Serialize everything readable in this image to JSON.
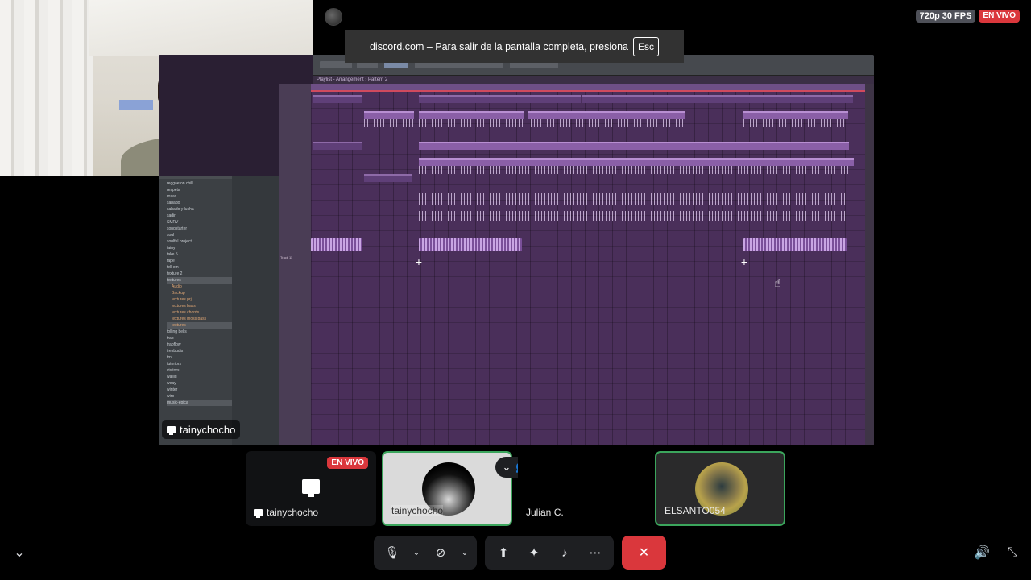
{
  "stream": {
    "quality": "720p 30 FPS",
    "live_label": "EN VIVO"
  },
  "toast": {
    "message": "discord.com – Para salir de la pantalla completa, presiona",
    "key": "Esc"
  },
  "shared_screen": {
    "owner": "tainychocho",
    "fl_title": "Playlist - Arrangement › Pattern 2",
    "track_label": "Track 11",
    "browser_items": [
      "reggaeton chill",
      "respeta",
      "rosas",
      "sabado",
      "sabado y lucha",
      "sadir",
      "SMRV",
      "songstarter",
      "soul",
      "soulful project",
      "tainy",
      "take 5",
      "tape",
      "tell em",
      "texture 2",
      "textures"
    ],
    "browser_subitems": [
      "Audio",
      "Backup",
      "textures.prj",
      "textures bass",
      "textures chords",
      "textures moss bass",
      "textures"
    ],
    "browser_items_after": [
      "tolling bells",
      "trap",
      "trapflow",
      "tresbudis",
      "trn",
      "tutoriors",
      "visitors",
      "wallid",
      "weay",
      "winter",
      "wiro",
      "winters"
    ],
    "browser_footer": "music-epica"
  },
  "participants": [
    {
      "name": "tainychocho",
      "live": "EN VIVO",
      "type": "screen"
    },
    {
      "name": "tainychocho",
      "type": "avatar"
    },
    {
      "name": "Julian C.",
      "type": "empty"
    },
    {
      "name": "ELSANTO054",
      "type": "avatar"
    }
  ],
  "controls": {
    "mic_icon": "microphone-icon",
    "camera_icon": "camera-off-icon",
    "share_icon": "screen-share-icon",
    "activity_icon": "activities-icon",
    "soundboard_icon": "soundboard-icon",
    "more_icon": "more-icon",
    "hangup_icon": "leave-call-icon"
  },
  "colors": {
    "live_red": "#da373c",
    "speaking_green": "#3ba55c",
    "fl_purple": "#4a2f5a"
  }
}
